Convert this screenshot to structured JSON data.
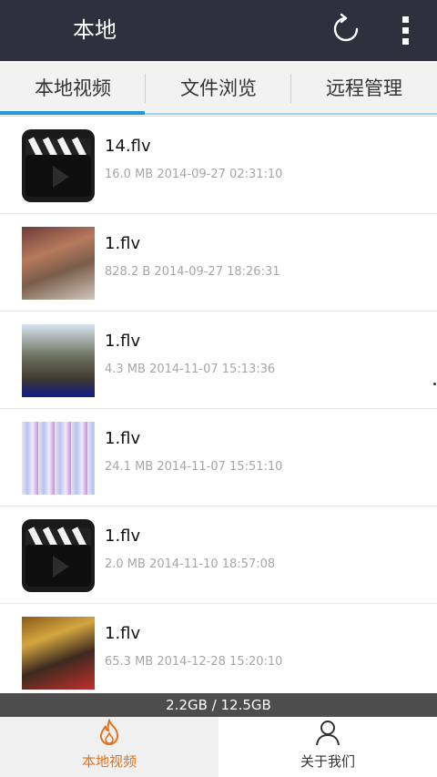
{
  "header": {
    "title": "本地"
  },
  "tabs": [
    {
      "label": "本地视频",
      "active": true
    },
    {
      "label": "文件浏览",
      "active": false
    },
    {
      "label": "远程管理",
      "active": false
    }
  ],
  "files": [
    {
      "name": "14.flv",
      "size": "16.0 MB",
      "date": "2014-09-27 02:31:10",
      "thumb": "clapperboard-icon"
    },
    {
      "name": "1.flv",
      "size": "828.2 B",
      "date": "2014-09-27 18:26:31",
      "thumb": "video-thumbnail"
    },
    {
      "name": "1.flv",
      "size": "4.3 MB",
      "date": "2014-11-07 15:13:36",
      "thumb": "video-thumbnail"
    },
    {
      "name": "1.flv",
      "size": "24.1 MB",
      "date": "2014-11-07 15:51:10",
      "thumb": "video-thumbnail"
    },
    {
      "name": "1.flv",
      "size": "2.0 MB",
      "date": "2014-11-10 18:57:08",
      "thumb": "clapperboard-icon"
    },
    {
      "name": "1.flv",
      "size": "65.3 MB",
      "date": "2014-12-28 15:20:10",
      "thumb": "video-thumbnail"
    }
  ],
  "storage": {
    "text": "2.2GB / 12.5GB"
  },
  "bottom_nav": [
    {
      "label": "本地视频",
      "icon": "flame-icon",
      "active": true
    },
    {
      "label": "关于我们",
      "icon": "user-icon",
      "active": false
    }
  ],
  "colors": {
    "titlebar": "#2f2f3d",
    "tab_underline": "#1e9bd7",
    "active_nav": "#e0741c",
    "storage_bar": "#4d4d4d"
  }
}
